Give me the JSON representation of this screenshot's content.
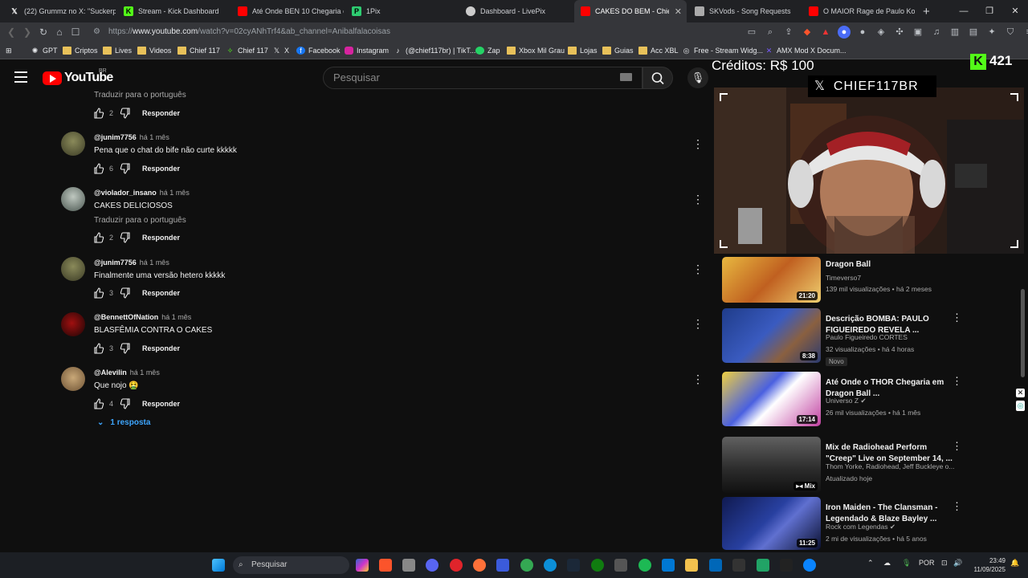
{
  "browser": {
    "tabs": [
      {
        "label": "(22) Grummz no X: \"Suckerpunch",
        "color": "#000000",
        "icon": "x-icon"
      },
      {
        "label": "Stream - Kick Dashboard",
        "color": "#53fc18",
        "icon": "kick-icon"
      },
      {
        "label": "Até Onde BEN 10 Chegaria em",
        "color": "#ff0000",
        "icon": "youtube-icon"
      },
      {
        "label": "1Pix",
        "color": "#2ecc71",
        "icon": "pix-icon"
      },
      {
        "label": "Dashboard - LivePix",
        "color": "#cccccc",
        "icon": "livepix-icon"
      },
      {
        "label": "CAKES DO BEM - Chief117",
        "color": "#ff0000",
        "icon": "youtube-icon"
      },
      {
        "label": "SKVods - Song Requests",
        "color": "#cccccc",
        "icon": "skvods-icon"
      },
      {
        "label": "O MAIOR Rage de Paulo Kogos",
        "color": "#ff0000",
        "icon": "youtube-icon"
      }
    ],
    "url_prefix": "https://",
    "url_host": "www.youtube.com",
    "url_path": "/watch?v=02cyANhTrf4&ab_channel=Anibalfalacoisas",
    "bookmarks": [
      "GPT",
      "Criptos",
      "Lives",
      "Videos",
      "Chief 117",
      "Chief 117",
      "X",
      "Facebook",
      "Instagram",
      "(@chief117br) | TikT...",
      "Zap",
      "Xbox Mil Grau",
      "Lojas",
      "Guias",
      "Acc XBL",
      "Free - Stream Widg...",
      "AMX Mod X Docum..."
    ]
  },
  "youtube": {
    "logo_text": "YouTube",
    "country": "BR",
    "search_placeholder": "Pesquisar"
  },
  "comments": {
    "top_translate": "Traduzir para o português",
    "top_likes": "2",
    "reply_label": "Responder",
    "items": [
      {
        "handle": "@junim7756",
        "when": "há 1 mês",
        "text": "Pena que o chat do bife não curte kkkkk",
        "likes": "6"
      },
      {
        "handle": "@violador_insano",
        "when": "há 1 mês",
        "text": "CAKES DELICIOSOS",
        "translate": "Traduzir para o português",
        "likes": "2"
      },
      {
        "handle": "@junim7756",
        "when": "há 1 mês",
        "text": "Finalmente uma versão hetero kkkkk",
        "likes": "3"
      },
      {
        "handle": "@BennettOfNation",
        "when": "há 1 mês",
        "text": "BLASFÊMIA CONTRA O CAKES",
        "likes": "3"
      },
      {
        "handle": "@Alevilin",
        "when": "há 1 mês",
        "text": "Que nojo 🤮",
        "likes": "4"
      }
    ],
    "replies_toggle": "1 resposta"
  },
  "recommendations": [
    {
      "title": "Dragon Ball",
      "channel": "Timeverso7",
      "meta": "139 mil visualizações • há 2 meses",
      "duration": "21:20",
      "thumb_color": "#d9a441"
    },
    {
      "title": "Descrição BOMBA: PAULO FIGUEIREDO REVELA ...",
      "channel": "Paulo Figueiredo CORTES",
      "meta": "32 visualizações • há 4 horas",
      "duration": "8:38",
      "badge": "Novo",
      "thumb_color": "#2b4a9a"
    },
    {
      "title": "Até Onde o THOR Chegaria em Dragon Ball ...",
      "channel": "Universo Z",
      "meta": "26 mil visualizações • há 1 mês",
      "duration": "17:14",
      "thumb_color": "#6a7fd8"
    },
    {
      "title": "Mix de Radiohead Perform \"Creep\" Live on September 14, ...",
      "channel": "Thom Yorke, Radiohead, Jeff Buckleye o...",
      "meta": "Atualizado hoje",
      "duration": "Mix",
      "thumb_color": "#4a4a4a"
    },
    {
      "title": "Iron Maiden - The Clansman - Legendado & Blaze Bayley ...",
      "channel": "Rock com Legendas",
      "meta": "2 mi de visualizações • há 5 anos",
      "duration": "11:25",
      "thumb_color": "#1c2a6e"
    }
  ],
  "overlay": {
    "credits": "Créditos: R$ 100",
    "kick_count": "421",
    "x_handle": "CHIEF117BR"
  },
  "taskbar": {
    "search_label": "Pesquisar",
    "language": "POR",
    "time": "23:49",
    "date": "11/09/2025"
  }
}
